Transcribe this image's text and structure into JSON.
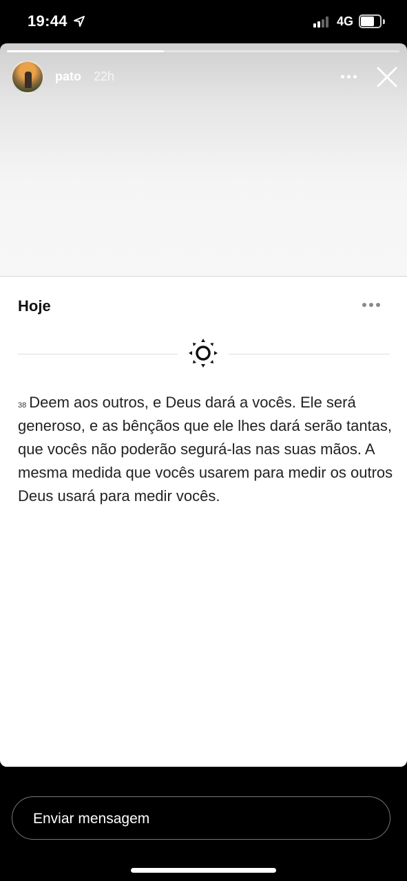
{
  "status_bar": {
    "time": "19:44",
    "network": "4G",
    "signal_bars": 2,
    "location_icon": "location-arrow-icon"
  },
  "story": {
    "username": "pato",
    "age": "22h",
    "progress": 0.4,
    "menu_icon": "more-horizontal-icon",
    "close_icon": "close-icon"
  },
  "card": {
    "title": "Hoje",
    "menu_icon": "more-horizontal-icon",
    "divider_icon": "sun-icon",
    "verse_number": "38",
    "verse_text": "Deem aos outros, e Deus dará a vocês. Ele será generoso, e as bênçãos que ele lhes dará serão tantas, que vocês não poderão segurá-las nas suas mãos. A mesma medida que vocês usarem para medir os outros Deus usará para medir vocês."
  },
  "reply": {
    "placeholder": "Enviar mensagem"
  }
}
